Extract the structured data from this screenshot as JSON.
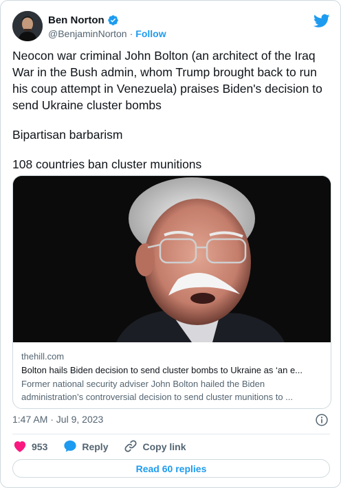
{
  "author": {
    "name": "Ben Norton",
    "handle": "@BenjaminNorton",
    "separator": "·",
    "follow_label": "Follow"
  },
  "tweet": {
    "paragraphs": [
      "Neocon war criminal John Bolton (an architect of the Iraq War in the Bush admin, whom Trump brought back to run his coup attempt in Venezuela) praises Biden's decision to send Ukraine cluster bombs",
      "Bipartisan barbarism",
      "108 countries ban cluster munitions"
    ]
  },
  "link_card": {
    "domain": "thehill.com",
    "title": "Bolton hails Biden decision to send cluster bombs to Ukraine as ‘an e...",
    "description_line1": "Former national security adviser John Bolton hailed the Biden",
    "description_line2": "administration’s controversial decision to send cluster munitions to ..."
  },
  "timestamp": "1:47 AM · Jul 9, 2023",
  "actions": {
    "like_count": "953",
    "reply_label": "Reply",
    "copy_link_label": "Copy link"
  },
  "read_replies_label": "Read 60 replies",
  "colors": {
    "accent": "#1d9bf0",
    "like": "#f91880",
    "text": "#0f1419",
    "secondary": "#536471"
  }
}
